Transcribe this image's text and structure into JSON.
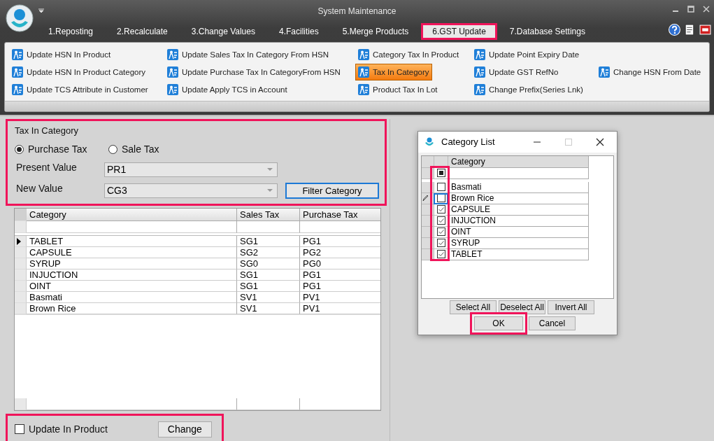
{
  "window": {
    "title": "System Maintenance"
  },
  "tabs": [
    {
      "label": "1.Reposting",
      "selected": false,
      "highlighted": false
    },
    {
      "label": "2.Recalculate",
      "selected": false,
      "highlighted": false
    },
    {
      "label": "3.Change Values",
      "selected": false,
      "highlighted": false
    },
    {
      "label": "4.Facilities",
      "selected": false,
      "highlighted": false
    },
    {
      "label": "5.Merge Products",
      "selected": false,
      "highlighted": false
    },
    {
      "label": "6.GST Update",
      "selected": true,
      "highlighted": true
    },
    {
      "label": "7.Database Settings",
      "selected": false,
      "highlighted": false
    }
  ],
  "ribbon": {
    "rows": [
      [
        {
          "label": "Update HSN In Product",
          "selected": false
        },
        {
          "label": "Update Sales Tax In Category From HSN",
          "selected": false
        },
        {
          "label": "Category Tax In Product",
          "selected": false
        },
        {
          "label": "Update Point Expiry Date",
          "selected": false
        }
      ],
      [
        {
          "label": "Update HSN In Product Category",
          "selected": false
        },
        {
          "label": "Update Purchase Tax In CategoryFrom HSN",
          "selected": false
        },
        {
          "label": "Tax In Category",
          "selected": true
        },
        {
          "label": "Update GST RefNo",
          "selected": false
        },
        {
          "label": "Change HSN From Date",
          "selected": false
        }
      ],
      [
        {
          "label": "Update TCS Attribute in Customer",
          "selected": false
        },
        {
          "label": "Update Apply TCS in Account",
          "selected": false
        },
        {
          "label": "Product Tax In Lot",
          "selected": false
        },
        {
          "label": "Change Prefix(Series Lnk)",
          "selected": false
        }
      ]
    ]
  },
  "tax_group": {
    "title": "Tax In Category",
    "highlighted": true,
    "radios": [
      {
        "label": "Purchase Tax",
        "selected": true
      },
      {
        "label": "Sale Tax",
        "selected": false
      }
    ],
    "present_value": {
      "label": "Present Value",
      "value": "PR1"
    },
    "new_value": {
      "label": "New Value",
      "value": "CG3"
    },
    "filter_button": "Filter Category"
  },
  "table": {
    "columns": [
      "Category",
      "Sales Tax",
      "Purchase Tax"
    ],
    "rows": [
      {
        "cells": [
          "TABLET",
          "SG1",
          "PG1"
        ],
        "current": true
      },
      {
        "cells": [
          "CAPSULE",
          "SG2",
          "PG2"
        ],
        "current": false
      },
      {
        "cells": [
          "SYRUP",
          "SG0",
          "PG0"
        ],
        "current": false
      },
      {
        "cells": [
          "INJUCTION",
          "SG1",
          "PG1"
        ],
        "current": false
      },
      {
        "cells": [
          "OINT",
          "SG1",
          "PG1"
        ],
        "current": false
      },
      {
        "cells": [
          "Basmati",
          "SV1",
          "PV1"
        ],
        "current": false
      },
      {
        "cells": [
          "Brown Rice",
          "SV1",
          "PV1"
        ],
        "current": false
      }
    ]
  },
  "bottom": {
    "highlighted": true,
    "checkbox": {
      "label": "Update In Product",
      "checked": false
    },
    "button": "Change"
  },
  "dialog": {
    "title": "Category List",
    "column": "Category",
    "header_checkbox_indeterminate": true,
    "checkbox_column_highlighted": true,
    "items": [
      {
        "label": "Basmati",
        "checked": false,
        "editing": false
      },
      {
        "label": "Brown Rice",
        "checked": false,
        "editing": true
      },
      {
        "label": "CAPSULE",
        "checked": true,
        "editing": false
      },
      {
        "label": "INJUCTION",
        "checked": true,
        "editing": false
      },
      {
        "label": "OINT",
        "checked": true,
        "editing": false
      },
      {
        "label": "SYRUP",
        "checked": true,
        "editing": false
      },
      {
        "label": "TABLET",
        "checked": true,
        "editing": false
      }
    ],
    "buttons": [
      "Select All",
      "Deselect All",
      "Invert All"
    ],
    "ok": {
      "label": "OK",
      "highlighted": true
    },
    "cancel": "Cancel"
  }
}
